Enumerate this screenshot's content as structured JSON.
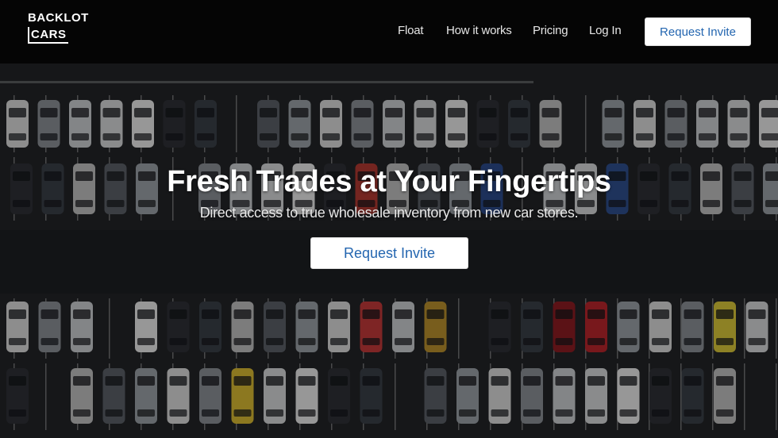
{
  "brand": {
    "line1": "BACKLOT",
    "line2": "CARS"
  },
  "nav": {
    "items": [
      "Float",
      "How it works",
      "Pricing",
      "Log In"
    ],
    "cta": "Request Invite"
  },
  "hero": {
    "headline": "Fresh Trades at Your Fingertips",
    "subheadline": "Direct access to true wholesale inventory from new car stores.",
    "cta": "Request Invite"
  },
  "colors": {
    "accent": "#2466b0",
    "header_bg": "#050505",
    "button_bg": "#ffffff"
  }
}
